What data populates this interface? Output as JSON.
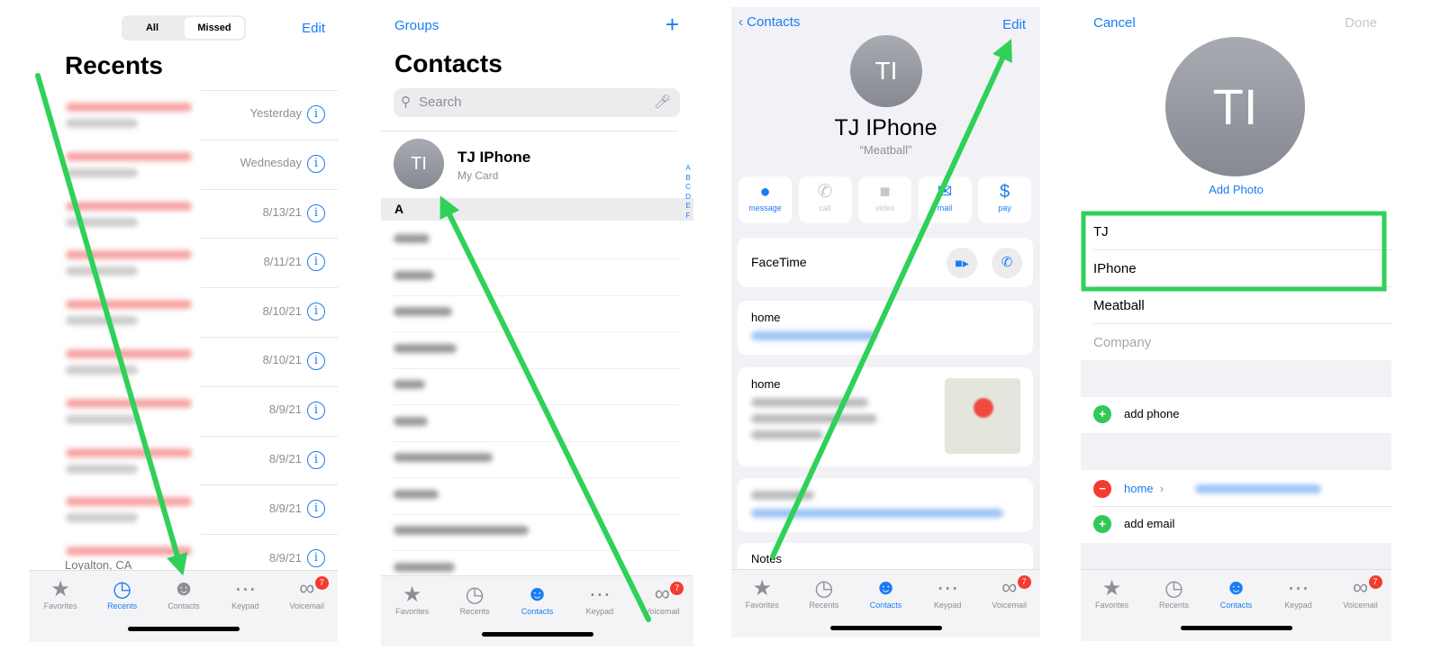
{
  "recents": {
    "segments": [
      "All",
      "Missed"
    ],
    "selected_segment": "Missed",
    "edit": "Edit",
    "title": "Recents",
    "items": [
      {
        "date": "Yesterday"
      },
      {
        "date": "Wednesday"
      },
      {
        "date": "8/13/21"
      },
      {
        "date": "8/11/21"
      },
      {
        "date": "8/10/21"
      },
      {
        "date": "8/10/21"
      },
      {
        "date": "8/9/21"
      },
      {
        "date": "8/9/21"
      },
      {
        "date": "8/9/21"
      },
      {
        "date": "8/9/21",
        "location": "Loyalton, CA"
      }
    ],
    "tab_selected": "Recents"
  },
  "tabs": [
    {
      "label": "Favorites",
      "icon": "star-icon"
    },
    {
      "label": "Recents",
      "icon": "clock-icon"
    },
    {
      "label": "Contacts",
      "icon": "person-circle-icon"
    },
    {
      "label": "Keypad",
      "icon": "keypad-icon"
    },
    {
      "label": "Voicemail",
      "icon": "voicemail-icon",
      "badge": "7"
    }
  ],
  "contacts": {
    "groups": "Groups",
    "add": "+",
    "title": "Contacts",
    "search_placeholder": "Search",
    "my_card": {
      "initials": "TI",
      "name": "TJ IPhone",
      "subtitle": "My Card"
    },
    "section": "A",
    "index": [
      "A",
      "B",
      "C",
      "D",
      "E",
      "F"
    ],
    "tab_selected": "Contacts"
  },
  "detail": {
    "back": "Contacts",
    "edit": "Edit",
    "initials": "TI",
    "name": "TJ IPhone",
    "nickname": "“Meatball”",
    "actions": [
      {
        "label": "message",
        "icon": "message-icon",
        "enabled": true
      },
      {
        "label": "call",
        "icon": "phone-icon",
        "enabled": false
      },
      {
        "label": "video",
        "icon": "video-icon",
        "enabled": false
      },
      {
        "label": "mail",
        "icon": "mail-icon",
        "enabled": true
      },
      {
        "label": "pay",
        "icon": "dollar-icon",
        "enabled": true
      }
    ],
    "facetime": "FaceTime",
    "email_label": "home",
    "address_label": "home",
    "notes": "Notes",
    "tab_selected": "Contacts"
  },
  "edit": {
    "cancel": "Cancel",
    "done": "Done",
    "initials": "TI",
    "add_photo": "Add Photo",
    "first_name": "TJ",
    "last_name": "IPhone",
    "nickname": "Meatball",
    "company_placeholder": "Company",
    "add_phone": "add phone",
    "email_label": "home",
    "add_email": "add email",
    "tab_selected": "Contacts"
  },
  "colors": {
    "accent": "#1a7cf5",
    "highlight": "#2fd158",
    "badge": "#f43b30",
    "missed": "#ff3b30"
  }
}
